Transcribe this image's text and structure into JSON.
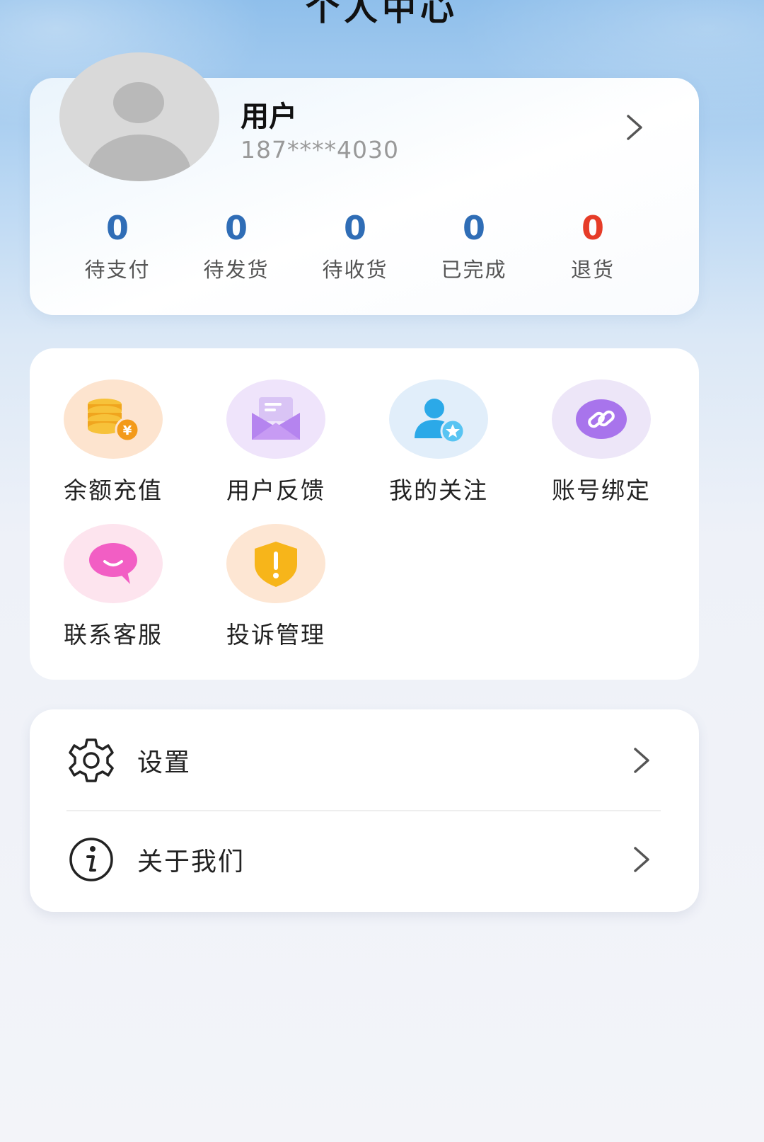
{
  "header": {
    "title": "个人中心"
  },
  "profile": {
    "name": "用户",
    "phone": "187****4030",
    "stats": [
      {
        "value": "0",
        "label": "待支付"
      },
      {
        "value": "0",
        "label": "待发货"
      },
      {
        "value": "0",
        "label": "待收货"
      },
      {
        "value": "0",
        "label": "已完成"
      },
      {
        "value": "0",
        "label": "退货"
      }
    ]
  },
  "services": [
    {
      "label": "余额充值",
      "icon": "coins-icon"
    },
    {
      "label": "用户反馈",
      "icon": "envelope-icon"
    },
    {
      "label": "我的关注",
      "icon": "user-star-icon"
    },
    {
      "label": "账号绑定",
      "icon": "link-icon"
    },
    {
      "label": "联系客服",
      "icon": "chat-bubble-icon"
    },
    {
      "label": "投诉管理",
      "icon": "shield-alert-icon"
    }
  ],
  "menu": [
    {
      "label": "设置",
      "icon": "gear-icon"
    },
    {
      "label": "关于我们",
      "icon": "info-icon"
    }
  ],
  "colors": {
    "accent": "#2f6db6",
    "refund": "#e63c28"
  }
}
